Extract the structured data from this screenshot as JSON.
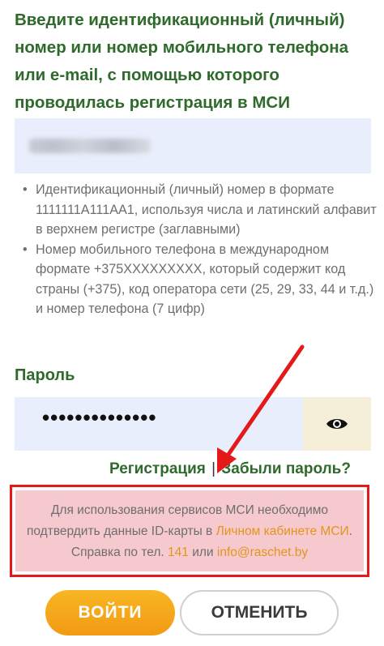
{
  "login": {
    "heading": "Введите идентификационный (личный) номер или номер мобильного телефона или e-mail, с помощью которого проводилась регистрация в МСИ",
    "hints": [
      "Идентификационный (личный) номер в формате 1111111A111AA1, используя числа и латинский алфавит в верхнем регистре (заглавными)",
      "Номер мобильного телефона в международном формате +375XXXXXXXXX, который содержит код страны (+375), код оператора сети (25, 29, 33, 44 и т.д.) и номер телефона (7 цифр)"
    ],
    "bullet": "•"
  },
  "password": {
    "label": "Пароль",
    "masked_value": "••••••••••••••"
  },
  "links": {
    "register": "Регистрация",
    "separator": "|",
    "forgot": "Забыли пароль?"
  },
  "notice": {
    "line1": "Для использования сервисов МСИ необходимо",
    "line2_pre": "подтвердить данные ID-карты в ",
    "cabinet_link": "Личном кабинете МСИ",
    "line2_post": ".",
    "line3_pre": "Справка по тел. ",
    "phone": "141",
    "line3_mid": " или ",
    "email": "info@raschet.by"
  },
  "buttons": {
    "login": "ВОЙТИ",
    "cancel": "ОТМЕНИТЬ"
  },
  "icons": {
    "show_password": "eye-icon"
  },
  "colors": {
    "heading_green": "#2e6a2a",
    "field_bg": "#e9eefc",
    "notice_border": "#e41a1a",
    "notice_bg": "#f6c9cf",
    "link_orange": "#e3951c",
    "primary_button": "#f4a31a"
  }
}
